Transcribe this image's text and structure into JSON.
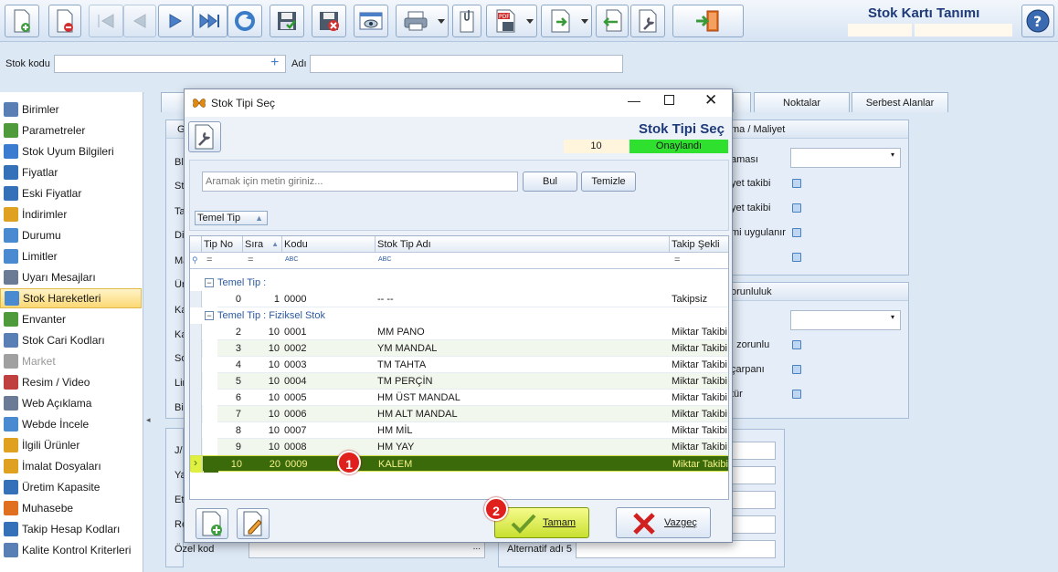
{
  "window": {
    "title": "Stok Kartı Tanımı"
  },
  "search": {
    "stok_kodu_label": "Stok kodu",
    "adi_label": "Adı",
    "stok_kodu_value": "",
    "adi_value": ""
  },
  "sidebar": {
    "items": [
      {
        "label": "Birimler",
        "color": "#5a7fb5"
      },
      {
        "label": "Parametreler",
        "color": "#4f9a3a"
      },
      {
        "label": "Stok Uyum Bilgileri",
        "color": "#3b7bd0"
      },
      {
        "label": "Fiyatlar",
        "color": "#3471b8"
      },
      {
        "label": "Eski Fiyatlar",
        "color": "#3471b8"
      },
      {
        "label": "İndirimler",
        "color": "#e0a020"
      },
      {
        "label": "Durumu",
        "color": "#4a8ad0"
      },
      {
        "label": "Limitler",
        "color": "#4a8ad0"
      },
      {
        "label": "Uyarı Mesajları",
        "color": "#6b7b95"
      },
      {
        "label": "Stok Hareketleri",
        "color": "#4a8ad0"
      },
      {
        "label": "Envanter",
        "color": "#4f9a3a"
      },
      {
        "label": "Stok Cari Kodları",
        "color": "#5a7fb5"
      },
      {
        "label": "Market",
        "color": "#a0a0a0"
      },
      {
        "label": "Resim / Video",
        "color": "#c04040"
      },
      {
        "label": "Web Açıklama",
        "color": "#6b7b95"
      },
      {
        "label": "Webde İncele",
        "color": "#4a8ad0"
      },
      {
        "label": "İlgili Ürünler",
        "color": "#e0a020"
      },
      {
        "label": "İmalat Dosyaları",
        "color": "#e0a020"
      },
      {
        "label": "Üretim Kapasite",
        "color": "#3471b8"
      },
      {
        "label": "Muhasebe",
        "color": "#e07020"
      },
      {
        "label": "Takip Hesap Kodları",
        "color": "#3471b8"
      },
      {
        "label": "Kalite Kontrol Kriterleri",
        "color": "#5a7fb5"
      }
    ],
    "selected_index": 9
  },
  "main": {
    "tabs": [
      "Noktalar",
      "Serbest Alanlar"
    ],
    "left_labels": [
      "Blo",
      "Sto",
      "Ta",
      "Dil",
      "Ma",
      "Ürü",
      "Ka",
      "Ka",
      "So",
      "Lin",
      "Bil"
    ],
    "lower_labels": [
      "J/",
      "Ya",
      "Et",
      "Re"
    ],
    "ozel_kod_label": "Özel kod",
    "ozel_kod_button": "...",
    "alternatif_label": "Alternatif adı 5",
    "maliyet_panel": {
      "title": "ma / Maliyet",
      "rows": [
        "aması",
        "yet takibi",
        "yet takibi",
        "mi uygulanır"
      ]
    },
    "zorunluluk_panel": {
      "title": "orunluluk",
      "rows": [
        "ı zorunlu",
        "çarpanı",
        "tür"
      ]
    }
  },
  "dialog": {
    "title": "Stok Tipi Seç",
    "header_title": "Stok Tipi Seç",
    "count": "10",
    "status": "Onaylandı",
    "status_color": "#2fe02f",
    "search_placeholder": "Aramak için metin giriniz...",
    "search_value": "",
    "find_button": "Bul",
    "clear_button": "Temizle",
    "group_chip": "Temel Tip",
    "columns": [
      "Tip No",
      "Sıra",
      "Kodu",
      "Stok Tip Adı",
      "Takip Şekli"
    ],
    "filter_eq": "=",
    "filter_abc": "ABC",
    "groups": [
      {
        "label": "Temel Tip :",
        "rows": [
          {
            "tip_no": "0",
            "sira": "1",
            "kodu": "0000",
            "adi": "-- --",
            "takip": "Takipsiz"
          }
        ]
      },
      {
        "label": "Temel Tip : Fiziksel Stok",
        "rows": [
          {
            "tip_no": "2",
            "sira": "10",
            "kodu": "0001",
            "adi": "MM PANO",
            "takip": "Miktar Takibi"
          },
          {
            "tip_no": "3",
            "sira": "10",
            "kodu": "0002",
            "adi": "YM MANDAL",
            "takip": "Miktar Takibi"
          },
          {
            "tip_no": "4",
            "sira": "10",
            "kodu": "0003",
            "adi": "TM TAHTA",
            "takip": "Miktar Takibi"
          },
          {
            "tip_no": "5",
            "sira": "10",
            "kodu": "0004",
            "adi": "TM PERÇİN",
            "takip": "Miktar Takibi"
          },
          {
            "tip_no": "6",
            "sira": "10",
            "kodu": "0005",
            "adi": "HM ÜST MANDAL",
            "takip": "Miktar Takibi"
          },
          {
            "tip_no": "7",
            "sira": "10",
            "kodu": "0006",
            "adi": "HM ALT MANDAL",
            "takip": "Miktar Takibi"
          },
          {
            "tip_no": "8",
            "sira": "10",
            "kodu": "0007",
            "adi": "HM MİL",
            "takip": "Miktar Takibi"
          },
          {
            "tip_no": "9",
            "sira": "10",
            "kodu": "0008",
            "adi": "HM YAY",
            "takip": "Miktar Takibi"
          },
          {
            "tip_no": "10",
            "sira": "20",
            "kodu": "0009",
            "adi": "KALEM",
            "takip": "Miktar Takibi",
            "selected": true
          }
        ]
      }
    ],
    "ok_button": "Tamam",
    "cancel_button": "Vazgeç",
    "badge1": "1",
    "badge2": "2"
  }
}
